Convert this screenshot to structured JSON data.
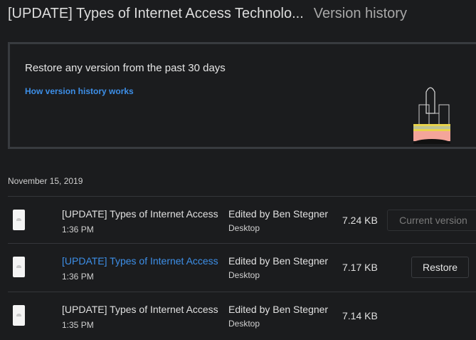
{
  "header": {
    "file_title": "[UPDATE] Types of Internet Access Technolo...",
    "subtitle": "Version history"
  },
  "banner": {
    "message": "Restore any version from the past 30 days",
    "link": "How version history works"
  },
  "date_group": "November 15, 2019",
  "versions": [
    {
      "name": "[UPDATE] Types of Internet Access",
      "time": "1:36 PM",
      "editor": "Edited by Ben Stegner",
      "device": "Desktop",
      "size": "7.24 KB",
      "action": "Current version"
    },
    {
      "name": "[UPDATE] Types of Internet Access",
      "time": "1:36 PM",
      "editor": "Edited by Ben Stegner",
      "device": "Desktop",
      "size": "7.17 KB",
      "action": "Restore"
    },
    {
      "name": "[UPDATE] Types of Internet Access",
      "time": "1:35 PM",
      "editor": "Edited by Ben Stegner",
      "device": "Desktop",
      "size": "7.14 KB"
    }
  ],
  "colors": {
    "background": "#1b1c1e",
    "link": "#3d8fe8",
    "border": "#383b3f"
  }
}
